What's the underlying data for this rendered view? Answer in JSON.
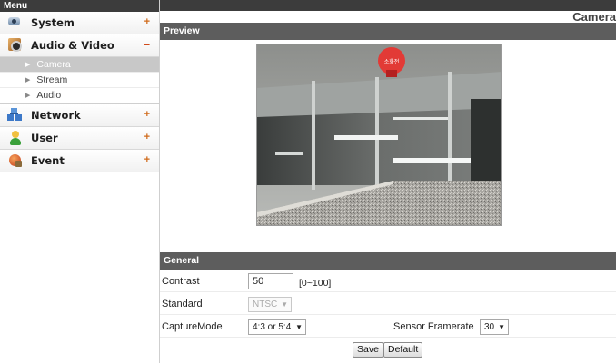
{
  "sidebar": {
    "header": "Menu",
    "items": [
      {
        "label": "System",
        "sign": "+"
      },
      {
        "label": "Audio & Video",
        "sign": "–",
        "sub": [
          "Camera",
          "Stream",
          "Audio"
        ]
      },
      {
        "label": "Network",
        "sign": "+"
      },
      {
        "label": "User",
        "sign": "+"
      },
      {
        "label": "Event",
        "sign": "+"
      }
    ]
  },
  "main": {
    "title": "Camera",
    "preview_header": "Preview",
    "general_header": "General",
    "contrast": {
      "label": "Contrast",
      "value": "50",
      "range": "[0~100]"
    },
    "standard": {
      "label": "Standard",
      "value": "NTSC"
    },
    "capture_mode": {
      "label": "CaptureMode",
      "value": "4:3 or 5:4"
    },
    "sensor_framerate": {
      "label": "Sensor Framerate",
      "value": "30"
    },
    "buttons": {
      "save": "Save",
      "default": "Default"
    },
    "preview_sign_text": "소화전"
  },
  "icons": {
    "system": "system-camera-icon",
    "audio_video": "audio-video-icon",
    "network": "network-icon",
    "user": "user-icon",
    "event": "event-icon"
  },
  "colors": {
    "menu_header_bg": "#3c3c3c",
    "section_header_bg": "#5d5d5d",
    "active_sub_bg": "#c8c8c8",
    "sign_color": "#d06a1a"
  }
}
